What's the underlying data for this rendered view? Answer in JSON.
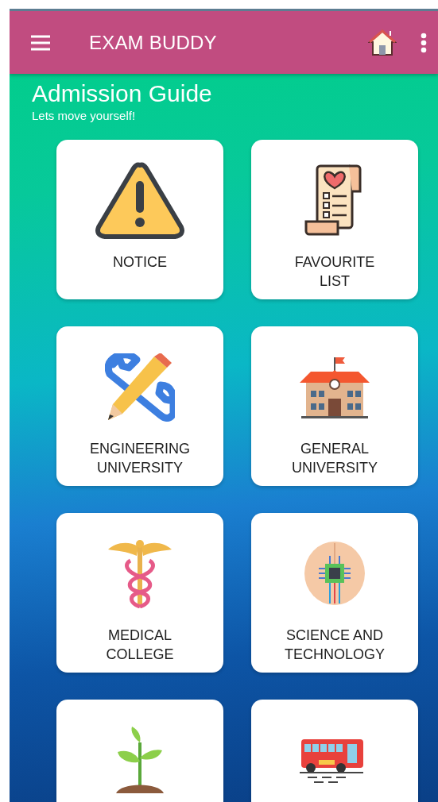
{
  "app_bar": {
    "title": "EXAM BUDDY"
  },
  "header": {
    "title": "Admission Guide",
    "subtitle": "Lets move yourself!"
  },
  "tiles": [
    {
      "kind": "labeled",
      "label": "NOTICE"
    },
    {
      "kind": "labeled",
      "label": "FAVOURITE\nLIST"
    },
    {
      "kind": "labeled",
      "label": "ENGINEERING\nUNIVERSITY"
    },
    {
      "kind": "labeled",
      "label": "GENERAL\nUNIVERSITY"
    },
    {
      "kind": "labeled",
      "label": "MEDICAL\nCOLLEGE"
    },
    {
      "kind": "labeled",
      "label": "SCIENCE AND\nTECHNOLOGY"
    },
    {
      "kind": "partial"
    },
    {
      "kind": "partial"
    }
  ]
}
